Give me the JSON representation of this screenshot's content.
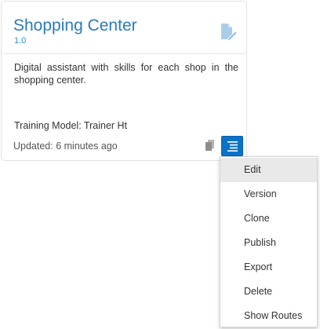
{
  "card": {
    "title": "Shopping Center",
    "version": "1.0",
    "description": "Digital assistant with skills for each shop in the shopping center.",
    "training_model": "Training Model: Trainer Ht",
    "updated": "Updated: 6 minutes ago",
    "accent_color": "#2b7bb9"
  },
  "icons": {
    "header": "edit-document-icon",
    "copy": "copy-icon",
    "menu": "hamburger-menu-icon"
  },
  "menu": {
    "items": [
      {
        "label": "Edit",
        "active": true
      },
      {
        "label": "Version",
        "active": false
      },
      {
        "label": "Clone",
        "active": false
      },
      {
        "label": "Publish",
        "active": false
      },
      {
        "label": "Export",
        "active": false
      },
      {
        "label": "Delete",
        "active": false
      },
      {
        "label": "Show Routes",
        "active": false
      }
    ]
  }
}
